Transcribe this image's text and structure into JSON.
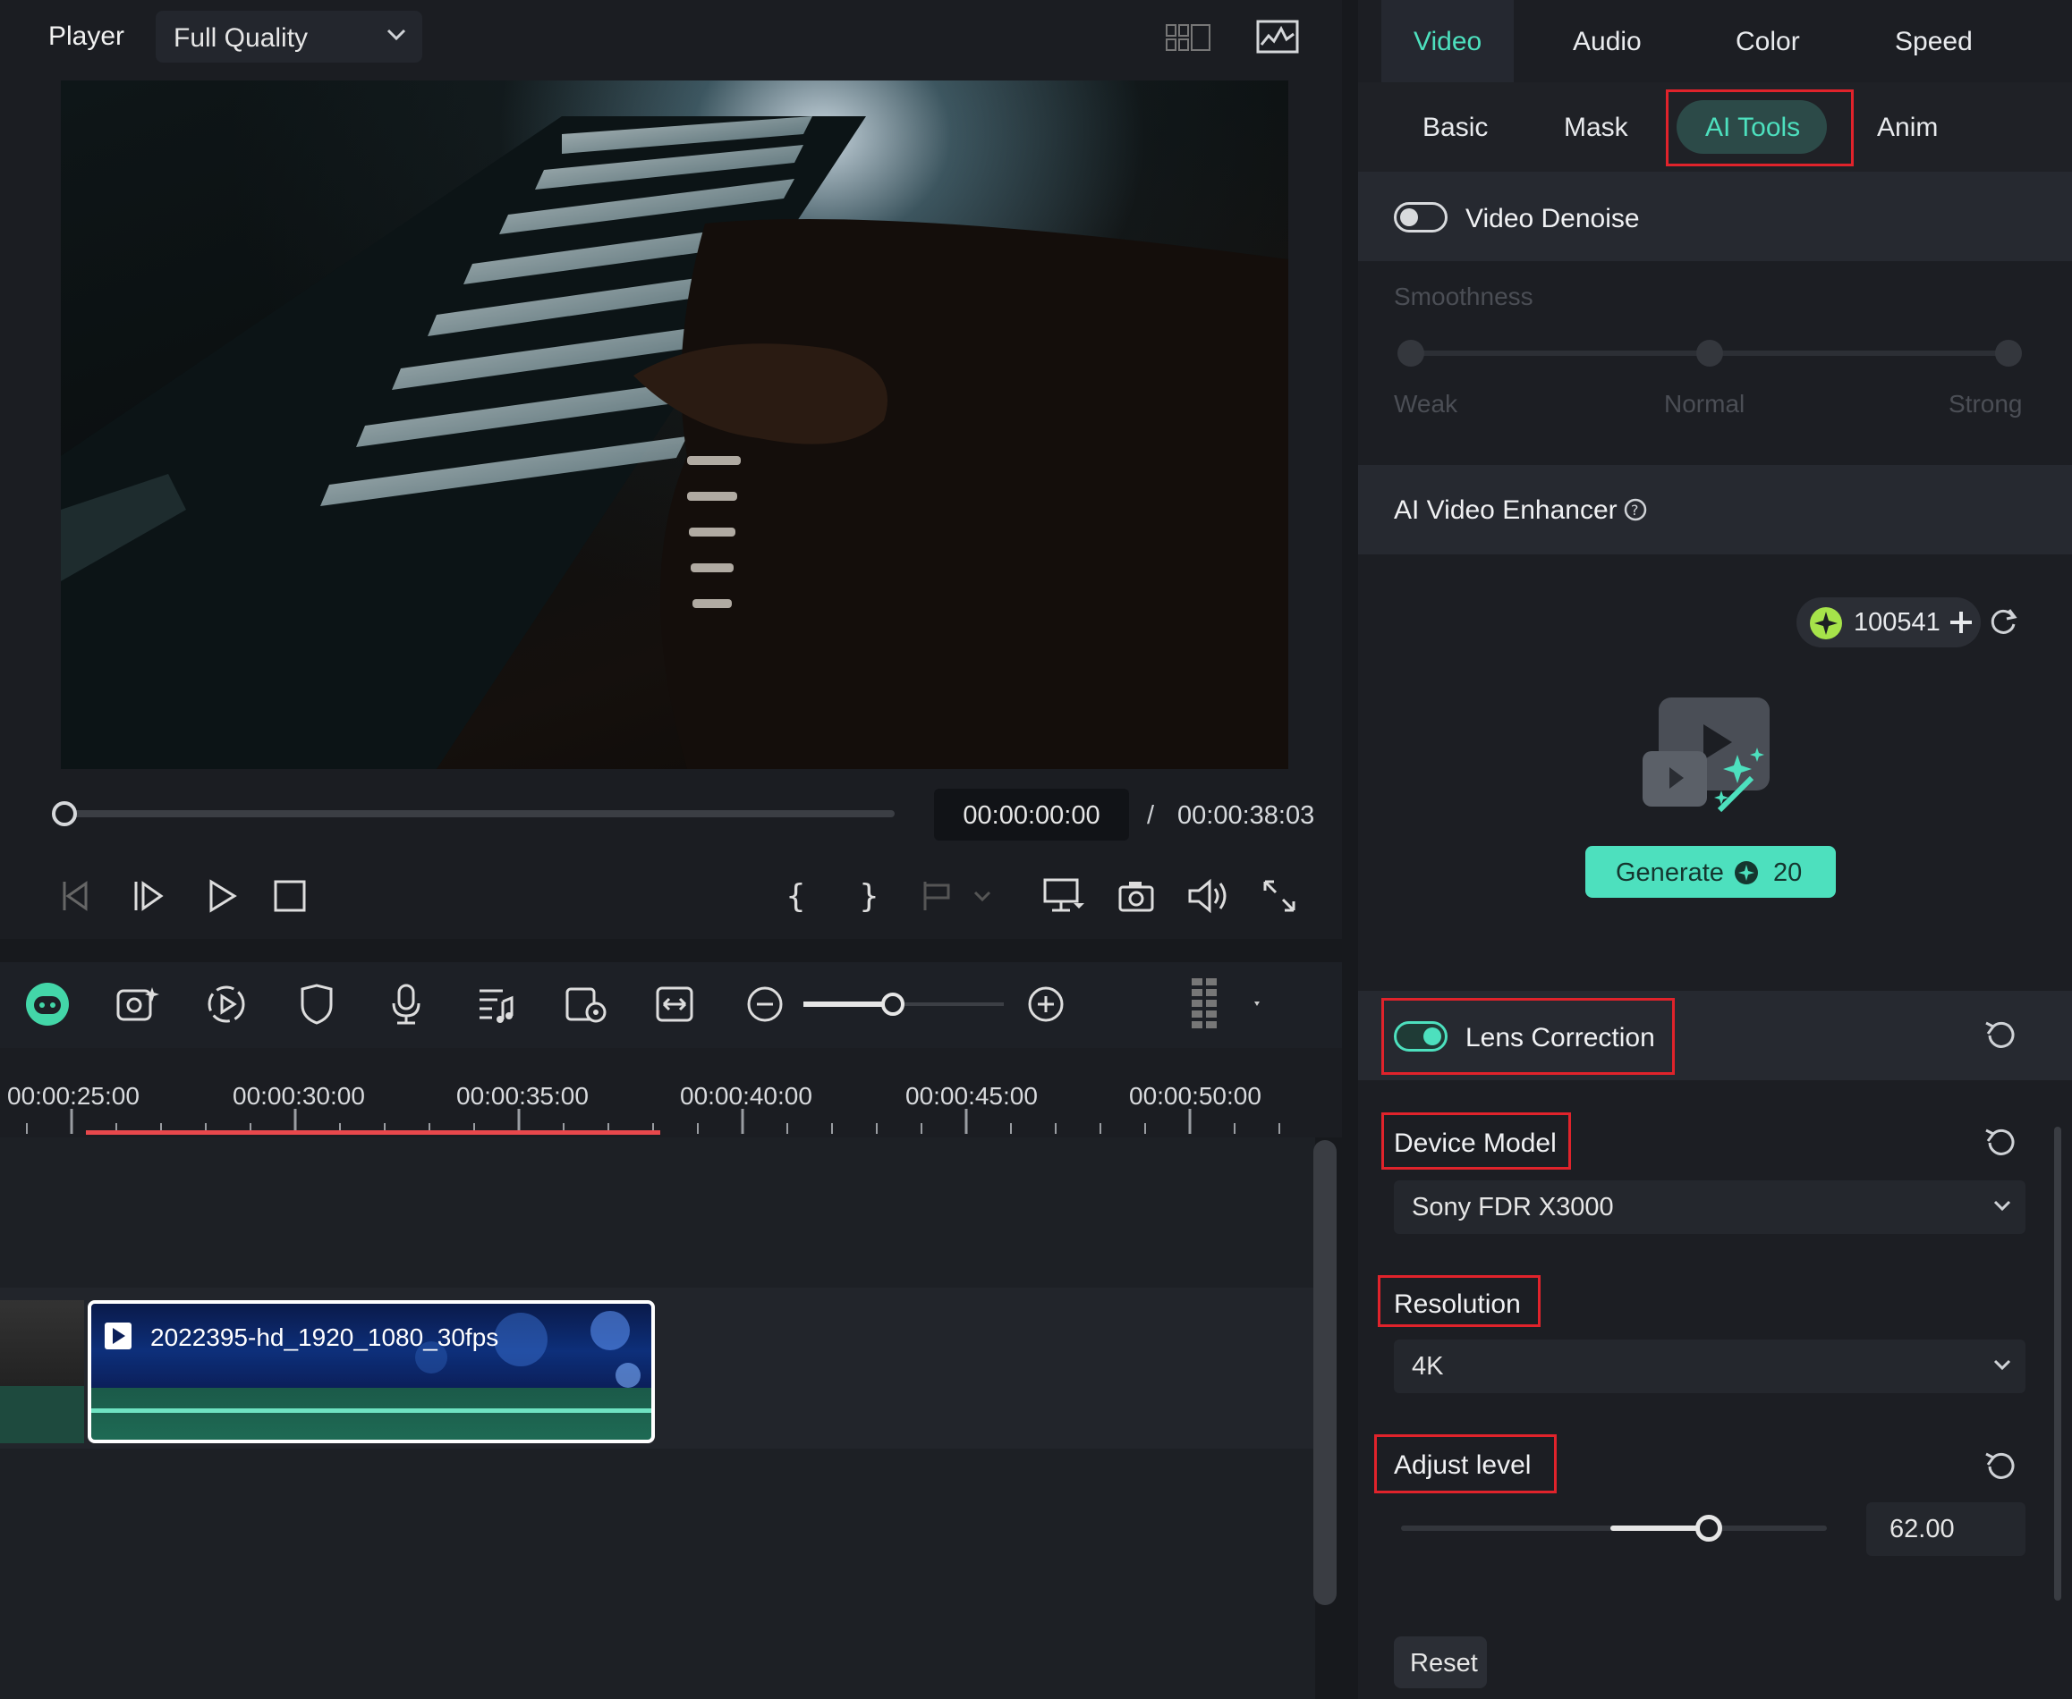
{
  "player": {
    "label": "Player",
    "quality": "Full Quality",
    "current_time": "00:00:00:00",
    "separator": "/",
    "total_time": "00:00:38:03",
    "progress": 0
  },
  "timeline": {
    "ticks": [
      "00:00:25:00",
      "00:00:30:00",
      "00:00:35:00",
      "00:00:40:00",
      "00:00:45:00",
      "00:00:50:00"
    ],
    "clip_name": "2022395-hd_1920_1080_30fps",
    "zoom_level": 0.5
  },
  "inspector": {
    "tabs": [
      "Video",
      "Audio",
      "Color",
      "Speed"
    ],
    "active_tab": "Video",
    "subtabs": [
      "Basic",
      "Mask",
      "AI Tools",
      "Anim"
    ],
    "active_subtab": "AI Tools",
    "video_denoise": {
      "label": "Video Denoise",
      "enabled": false,
      "smoothness_label": "Smoothness",
      "levels": [
        "Weak",
        "Normal",
        "Strong"
      ],
      "value": "Normal"
    },
    "ai_enhancer": {
      "label": "AI Video Enhancer",
      "credits": "100541",
      "generate_label": "Generate",
      "generate_cost": "20"
    },
    "lens_correction": {
      "label": "Lens Correction",
      "enabled": true,
      "device_model_label": "Device Model",
      "device_model": "Sony FDR X3000",
      "resolution_label": "Resolution",
      "resolution": "4K",
      "adjust_level_label": "Adjust level",
      "adjust_level": "62.00",
      "adjust_fraction": 0.79
    },
    "reset_label": "Reset"
  },
  "colors": {
    "accent": "#4de0be",
    "highlight_box": "#e0232b",
    "playhead_range": "#e8484c"
  }
}
